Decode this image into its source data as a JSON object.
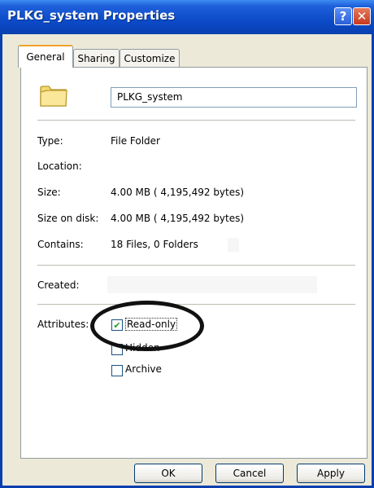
{
  "window": {
    "title": "PLKG_system Properties",
    "help_label": "?",
    "close_label": "✕"
  },
  "tabs": [
    {
      "label": "General",
      "active": true
    },
    {
      "label": "Sharing",
      "active": false
    },
    {
      "label": "Customize",
      "active": false
    }
  ],
  "general": {
    "icon": "folder-icon",
    "name": "PLKG_system",
    "type_label": "Type:",
    "type_value": "File Folder",
    "location_label": "Location:",
    "location_value": "",
    "size_label": "Size:",
    "size_value": "4.00 MB ( 4,195,492 bytes)",
    "size_on_disk_label": "Size on disk:",
    "size_on_disk_value": "4.00 MB ( 4,195,492 bytes)",
    "contains_label": "Contains:",
    "contains_value": "18 Files, 0 Folders",
    "created_label": "Created:",
    "created_value": "",
    "attributes_label": "Attributes:",
    "attributes": [
      {
        "label": "Read-only",
        "checked": true
      },
      {
        "label": "Hidden",
        "checked": false
      },
      {
        "label": "Archive",
        "checked": false
      }
    ]
  },
  "buttons": {
    "ok": "OK",
    "cancel": "Cancel",
    "apply": "Apply"
  },
  "colors": {
    "titlebar": "#0A3FB0",
    "dialog_bg": "#ECE9D8",
    "tab_highlight": "#F1A22A",
    "checkmark": "#21A121"
  }
}
